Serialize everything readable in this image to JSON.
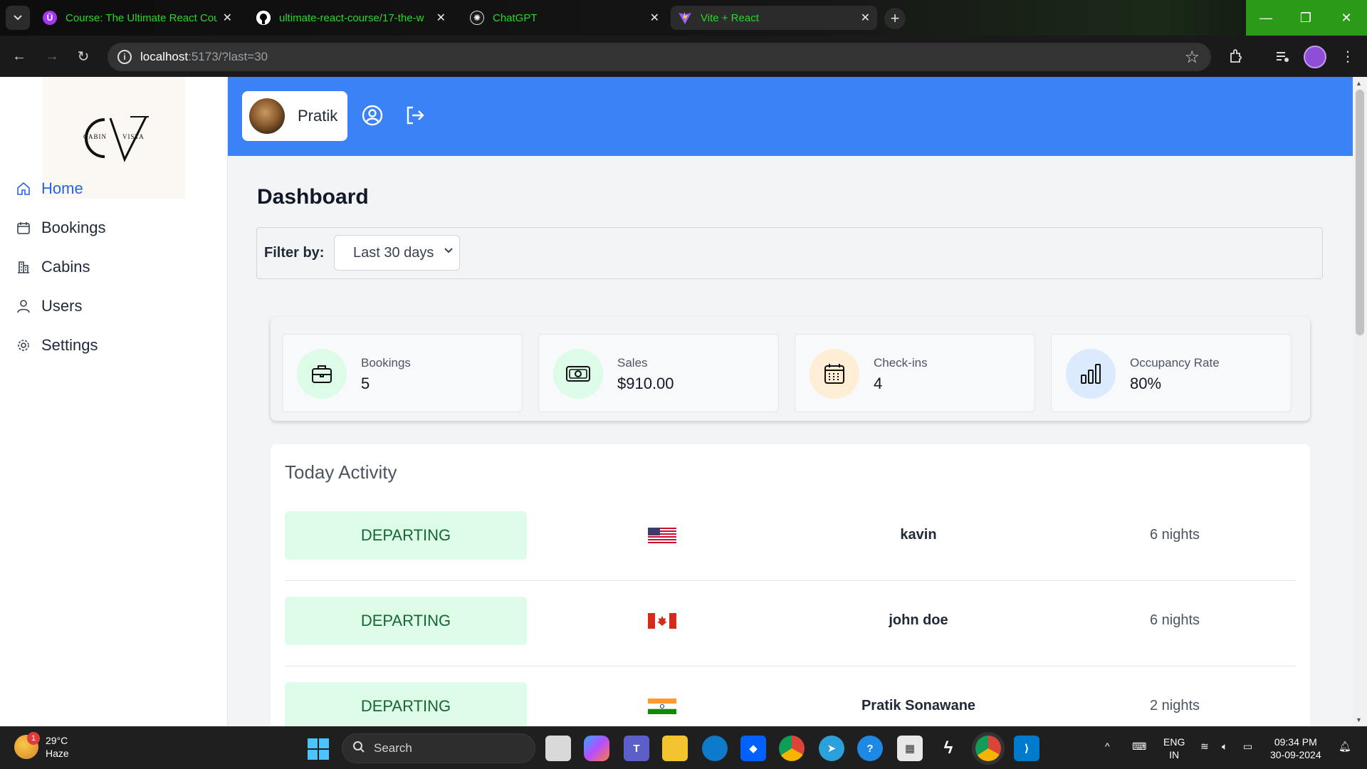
{
  "browser": {
    "tabs": [
      {
        "title": "Course: The Ultimate React Cou",
        "icon": "udemy-icon",
        "active": false
      },
      {
        "title": "ultimate-react-course/17-the-w",
        "icon": "github-icon",
        "active": false
      },
      {
        "title": "ChatGPT",
        "icon": "chatgpt-icon",
        "active": false
      },
      {
        "title": "Vite + React",
        "icon": "vite-icon",
        "active": true
      }
    ],
    "url_host": "localhost",
    "url_rest": ":5173/?last=30"
  },
  "app": {
    "logo_text": "CV",
    "logo_left": "CABIN",
    "logo_right": "VISTA",
    "nav": [
      {
        "label": "Home",
        "icon": "home-icon",
        "active": true
      },
      {
        "label": "Bookings",
        "icon": "calendar-icon",
        "active": false
      },
      {
        "label": "Cabins",
        "icon": "building-icon",
        "active": false
      },
      {
        "label": "Users",
        "icon": "user-icon",
        "active": false
      },
      {
        "label": "Settings",
        "icon": "gear-icon",
        "active": false
      }
    ],
    "header": {
      "user_name": "Pratik"
    },
    "page_title": "Dashboard",
    "filter": {
      "label": "Filter by:",
      "selected": "Last 30 days"
    },
    "stats": [
      {
        "label": "Bookings",
        "value": "5",
        "icon": "briefcase-icon",
        "color": "#dcfce7"
      },
      {
        "label": "Sales",
        "value": "$910.00",
        "icon": "banknote-icon",
        "color": "#dcfce7"
      },
      {
        "label": "Check-ins",
        "value": "4",
        "icon": "calendar-days-icon",
        "color": "#ffedd5"
      },
      {
        "label": "Occupancy Rate",
        "value": "80%",
        "icon": "bar-chart-icon",
        "color": "#dbeafe"
      }
    ],
    "activity": {
      "title": "Today Activity",
      "rows": [
        {
          "status": "DEPARTING",
          "flag": "us-flag-icon",
          "guest": "kavin",
          "nights": "6 nights"
        },
        {
          "status": "DEPARTING",
          "flag": "canada-flag-icon",
          "guest": "john doe",
          "nights": "6 nights"
        },
        {
          "status": "DEPARTING",
          "flag": "india-flag-icon",
          "guest": "Pratik Sonawane",
          "nights": "2 nights"
        }
      ]
    }
  },
  "taskbar": {
    "weather_temp": "29°C",
    "weather_desc": "Haze",
    "weather_badge": "1",
    "search_label": "Search",
    "lang_top": "ENG",
    "lang_bottom": "IN",
    "time": "09:34 PM",
    "date": "30-09-2024"
  }
}
